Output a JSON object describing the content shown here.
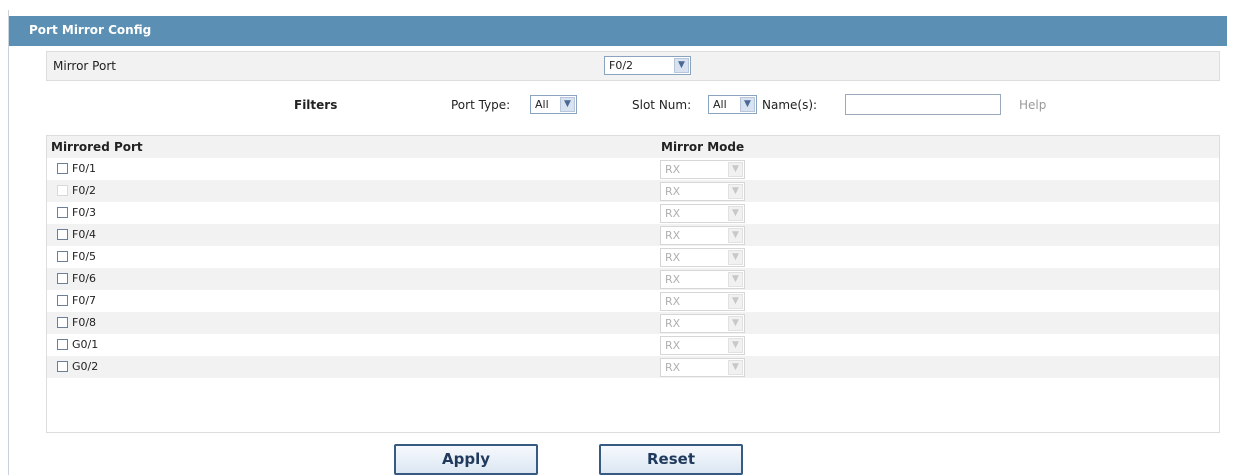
{
  "header": {
    "title": "Port Mirror Config"
  },
  "mirror_port": {
    "label": "Mirror Port",
    "value": "F0/2"
  },
  "filters": {
    "title": "Filters",
    "port_type_label": "Port Type:",
    "port_type_value": "All",
    "slot_num_label": "Slot Num:",
    "slot_num_value": "All",
    "names_label": "Name(s):",
    "names_value": "",
    "help_label": "Help"
  },
  "table": {
    "col_port": "Mirrored Port",
    "col_mode": "Mirror Mode",
    "rows": [
      {
        "port": "F0/1",
        "mode": "RX",
        "checked": false,
        "disabled": false
      },
      {
        "port": "F0/2",
        "mode": "RX",
        "checked": false,
        "disabled": true
      },
      {
        "port": "F0/3",
        "mode": "RX",
        "checked": false,
        "disabled": false
      },
      {
        "port": "F0/4",
        "mode": "RX",
        "checked": false,
        "disabled": false
      },
      {
        "port": "F0/5",
        "mode": "RX",
        "checked": false,
        "disabled": false
      },
      {
        "port": "F0/6",
        "mode": "RX",
        "checked": false,
        "disabled": false
      },
      {
        "port": "F0/7",
        "mode": "RX",
        "checked": false,
        "disabled": false
      },
      {
        "port": "F0/8",
        "mode": "RX",
        "checked": false,
        "disabled": false
      },
      {
        "port": "G0/1",
        "mode": "RX",
        "checked": false,
        "disabled": false
      },
      {
        "port": "G0/2",
        "mode": "RX",
        "checked": false,
        "disabled": false
      }
    ]
  },
  "buttons": {
    "apply": "Apply",
    "reset": "Reset"
  },
  "colors": {
    "header_bg": "#5b8fb4",
    "row_alt_bg": "#f2f2f2",
    "button_border": "#365a82"
  },
  "icons": {
    "select_arrow": "chevron-down-icon",
    "checkbox": "checkbox-icon"
  }
}
